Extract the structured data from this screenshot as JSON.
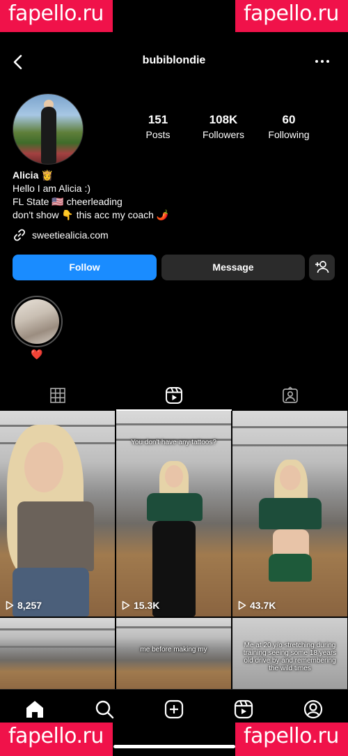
{
  "watermark": "fapello.ru",
  "profile": {
    "username": "bubiblondie",
    "display_name": "Alicia 👸",
    "bio_lines": [
      "Hello I am Alicia :)",
      "FL State 🇺🇸 cheerleading",
      "don't show 👇 this acc my coach 🌶️"
    ],
    "link": "sweetiealicia.com"
  },
  "stats": [
    {
      "value": "151",
      "label": "Posts"
    },
    {
      "value": "108K",
      "label": "Followers"
    },
    {
      "value": "60",
      "label": "Following"
    }
  ],
  "actions": {
    "follow": "Follow",
    "message": "Message"
  },
  "highlight": {
    "label": "❤️"
  },
  "tabs": [
    "grid-icon",
    "reels-icon",
    "tagged-icon"
  ],
  "active_tab": "reels",
  "reels": [
    {
      "views": "8,257",
      "caption": ""
    },
    {
      "views": "15.3K",
      "caption": "You don't have any tattoos?"
    },
    {
      "views": "43.7K",
      "caption": ""
    },
    {
      "views": "",
      "caption": ""
    },
    {
      "views": "",
      "caption": "me before making my"
    },
    {
      "views": "",
      "caption": "Me at 20 y/o stretching during training seeing some 18 years old drive by and remembering the wild times"
    }
  ],
  "navbar": [
    "home-icon",
    "search-icon",
    "create-icon",
    "reels-icon",
    "profile-icon"
  ],
  "colors": {
    "accent": "#1a8cff",
    "button_dark": "#2b2b2b",
    "watermark": "#f0124a"
  }
}
